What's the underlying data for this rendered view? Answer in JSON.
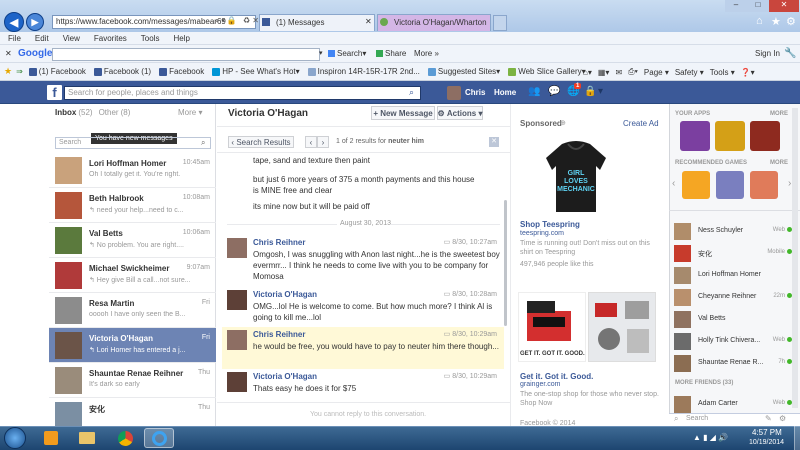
{
  "browser": {
    "address": "https://www.facebook.com/messages/mabear69",
    "tabs": [
      {
        "label": "(1) Messages"
      },
      {
        "label": "Victoria O'Hagan/Wharton"
      }
    ],
    "menu": [
      "File",
      "Edit",
      "View",
      "Favorites",
      "Tools",
      "Help"
    ],
    "google": {
      "label": "Google",
      "search": "Search",
      "share": "Share",
      "more": "More »",
      "sign_in": "Sign In"
    },
    "favorites": [
      "(1) Facebook",
      "Facebook (1)",
      "Facebook",
      "HP - See What's Hot",
      "Inspiron 14R-15R-17R 2nd...",
      "Suggested Sites",
      "Web Slice Gallery"
    ],
    "commands": [
      "Page",
      "Safety",
      "Tools"
    ]
  },
  "fb": {
    "search_placeholder": "Search for people, places and things",
    "user": "Chris",
    "home": "Home",
    "notif_count": "1"
  },
  "inbox": {
    "tab_inbox": "Inbox",
    "inbox_count": "(52)",
    "tab_other": "Other",
    "other_count": "(8)",
    "more": "More",
    "tooltip": "You have new messages",
    "search_placeholder": "Search",
    "threads": [
      {
        "name": "Lori Hoffman Homer",
        "time": "10:45am",
        "preview": "Oh I totally get it. You're right."
      },
      {
        "name": "Beth Halbrook",
        "time": "10:08am",
        "preview": "↰ need your help...need to c..."
      },
      {
        "name": "Val Betts",
        "time": "10:06am",
        "preview": "↰ No problem. You are right...."
      },
      {
        "name": "Michael Swickheimer",
        "time": "9:07am",
        "preview": "↰ Hey give Bill a call...not sure..."
      },
      {
        "name": "Resa Martin",
        "time": "Fri",
        "preview": "ooooh I have only seen the B..."
      },
      {
        "name": "Victoria O'Hagan",
        "time": "Fri",
        "preview": "↰ Lori Homer has entered a j..."
      },
      {
        "name": "Shauntae Renae Reihner",
        "time": "Thu",
        "preview": "It's dark so early"
      },
      {
        "name": "安化",
        "time": "Thu",
        "preview": ""
      }
    ]
  },
  "conversation": {
    "title": "Victoria O'Hagan",
    "new_message": "+ New Message",
    "actions": "Actions",
    "search_results": "Search Results",
    "results_text": "1 of 2 results for",
    "results_term": "neuter him",
    "date_divider": "August 30, 2013",
    "footer": "You cannot reply to this conversation.",
    "intro_lines": [
      "tape, sand and texture then paint",
      "but just 6 more years of 375 a month payments and this house is MINE free and clear",
      "its mine now but it will be paid off"
    ],
    "messages": [
      {
        "sender": "Chris Reihner",
        "time": "8/30, 10:27am",
        "text": "Omgosh, I was snuggling with Anon last night...he is the sweetest boy evermrr... I think he needs to come live with you to be company for Momosa"
      },
      {
        "sender": "Victoria O'Hagan",
        "time": "8/30, 10:28am",
        "text": "OMG...lol He is welcome to come. But how much more? I think Al is going to kill me...lol"
      },
      {
        "sender": "Chris Reihner",
        "time": "8/30, 10:29am",
        "text": "he would be free, you would have to pay to neuter him there though..."
      },
      {
        "sender": "Victoria O'Hagan",
        "time": "8/30, 10:29am",
        "text": "Thats easy he does it for $75"
      }
    ]
  },
  "ads": {
    "sponsored": "Sponsored",
    "create_ad": "Create Ad",
    "ad1": {
      "shirt_text": "GIRL LOVES MECHANIC",
      "title": "Shop Teespring",
      "domain": "teespring.com",
      "body": "Time is running out! Don't miss out on this shirt on Teespring",
      "likes": "497,946 people like this"
    },
    "ad2": {
      "caption": "GET IT. GOT IT. GOOD.",
      "title": "Get it. Got it. Good.",
      "domain": "grainger.com",
      "body": "The one-stop shop for those who never stop. Shop Now"
    },
    "footer": "Facebook © 2014"
  },
  "chat": {
    "your_apps": "YOUR APPS",
    "more": "MORE",
    "recommended": "RECOMMENDED GAMES",
    "more_friends": "MORE FRIENDS (33)",
    "search_placeholder": "Search",
    "friends": [
      {
        "name": "Ness Schuyler",
        "status": "Web"
      },
      {
        "name": "安化",
        "status": "Mobile"
      },
      {
        "name": "Lori Hoffman Homer",
        "status": ""
      },
      {
        "name": "Cheyanne Reihner",
        "status": "22m"
      },
      {
        "name": "Val Betts",
        "status": ""
      },
      {
        "name": "Holly Tink Chivera...",
        "status": "Web"
      },
      {
        "name": "Shauntae Renae R...",
        "status": "7h"
      }
    ],
    "more_friend": {
      "name": "Adam Carter",
      "status": "Web"
    }
  },
  "taskbar": {
    "time": "4:57 PM",
    "date": "10/19/2014"
  }
}
